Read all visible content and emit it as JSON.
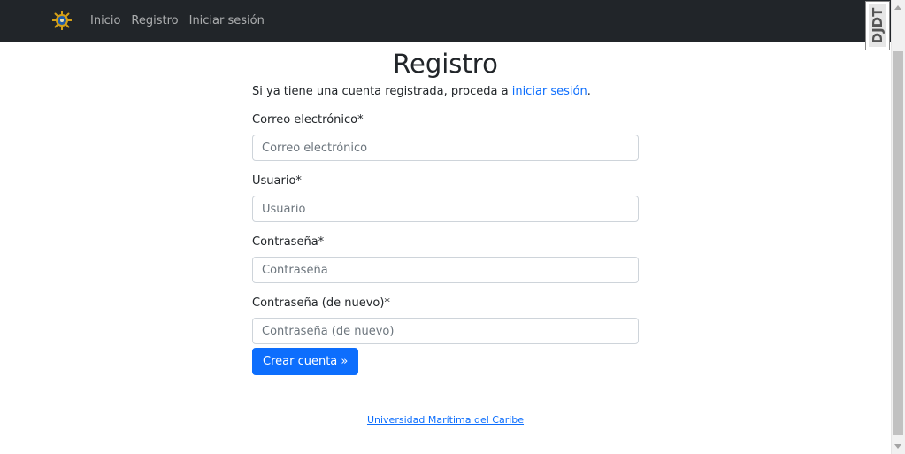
{
  "nav": {
    "brand_icon": "compass-logo-icon",
    "links": [
      "Inicio",
      "Registro",
      "Iniciar sesión"
    ]
  },
  "debug_toolbar": {
    "label": "DJDT"
  },
  "main": {
    "title": "Registro",
    "intro_prefix": "Si ya tiene una cuenta registrada, proceda a ",
    "intro_link": "iniciar sesión",
    "intro_suffix": ".",
    "fields": [
      {
        "label": "Correo electrónico*",
        "placeholder": "Correo electrónico",
        "value": ""
      },
      {
        "label": "Usuario*",
        "placeholder": "Usuario",
        "value": ""
      },
      {
        "label": "Contraseña*",
        "placeholder": "Contraseña",
        "value": ""
      },
      {
        "label": "Contraseña (de nuevo)*",
        "placeholder": "Contraseña (de nuevo)",
        "value": ""
      }
    ],
    "submit_label": "Crear cuenta »"
  },
  "footer": {
    "link": "Universidad Marítima del Caribe"
  },
  "colors": {
    "navbar_bg": "#212529",
    "primary": "#0d6efd",
    "brand_gold": "#d4a017",
    "brand_blue": "#1e5aa8"
  }
}
